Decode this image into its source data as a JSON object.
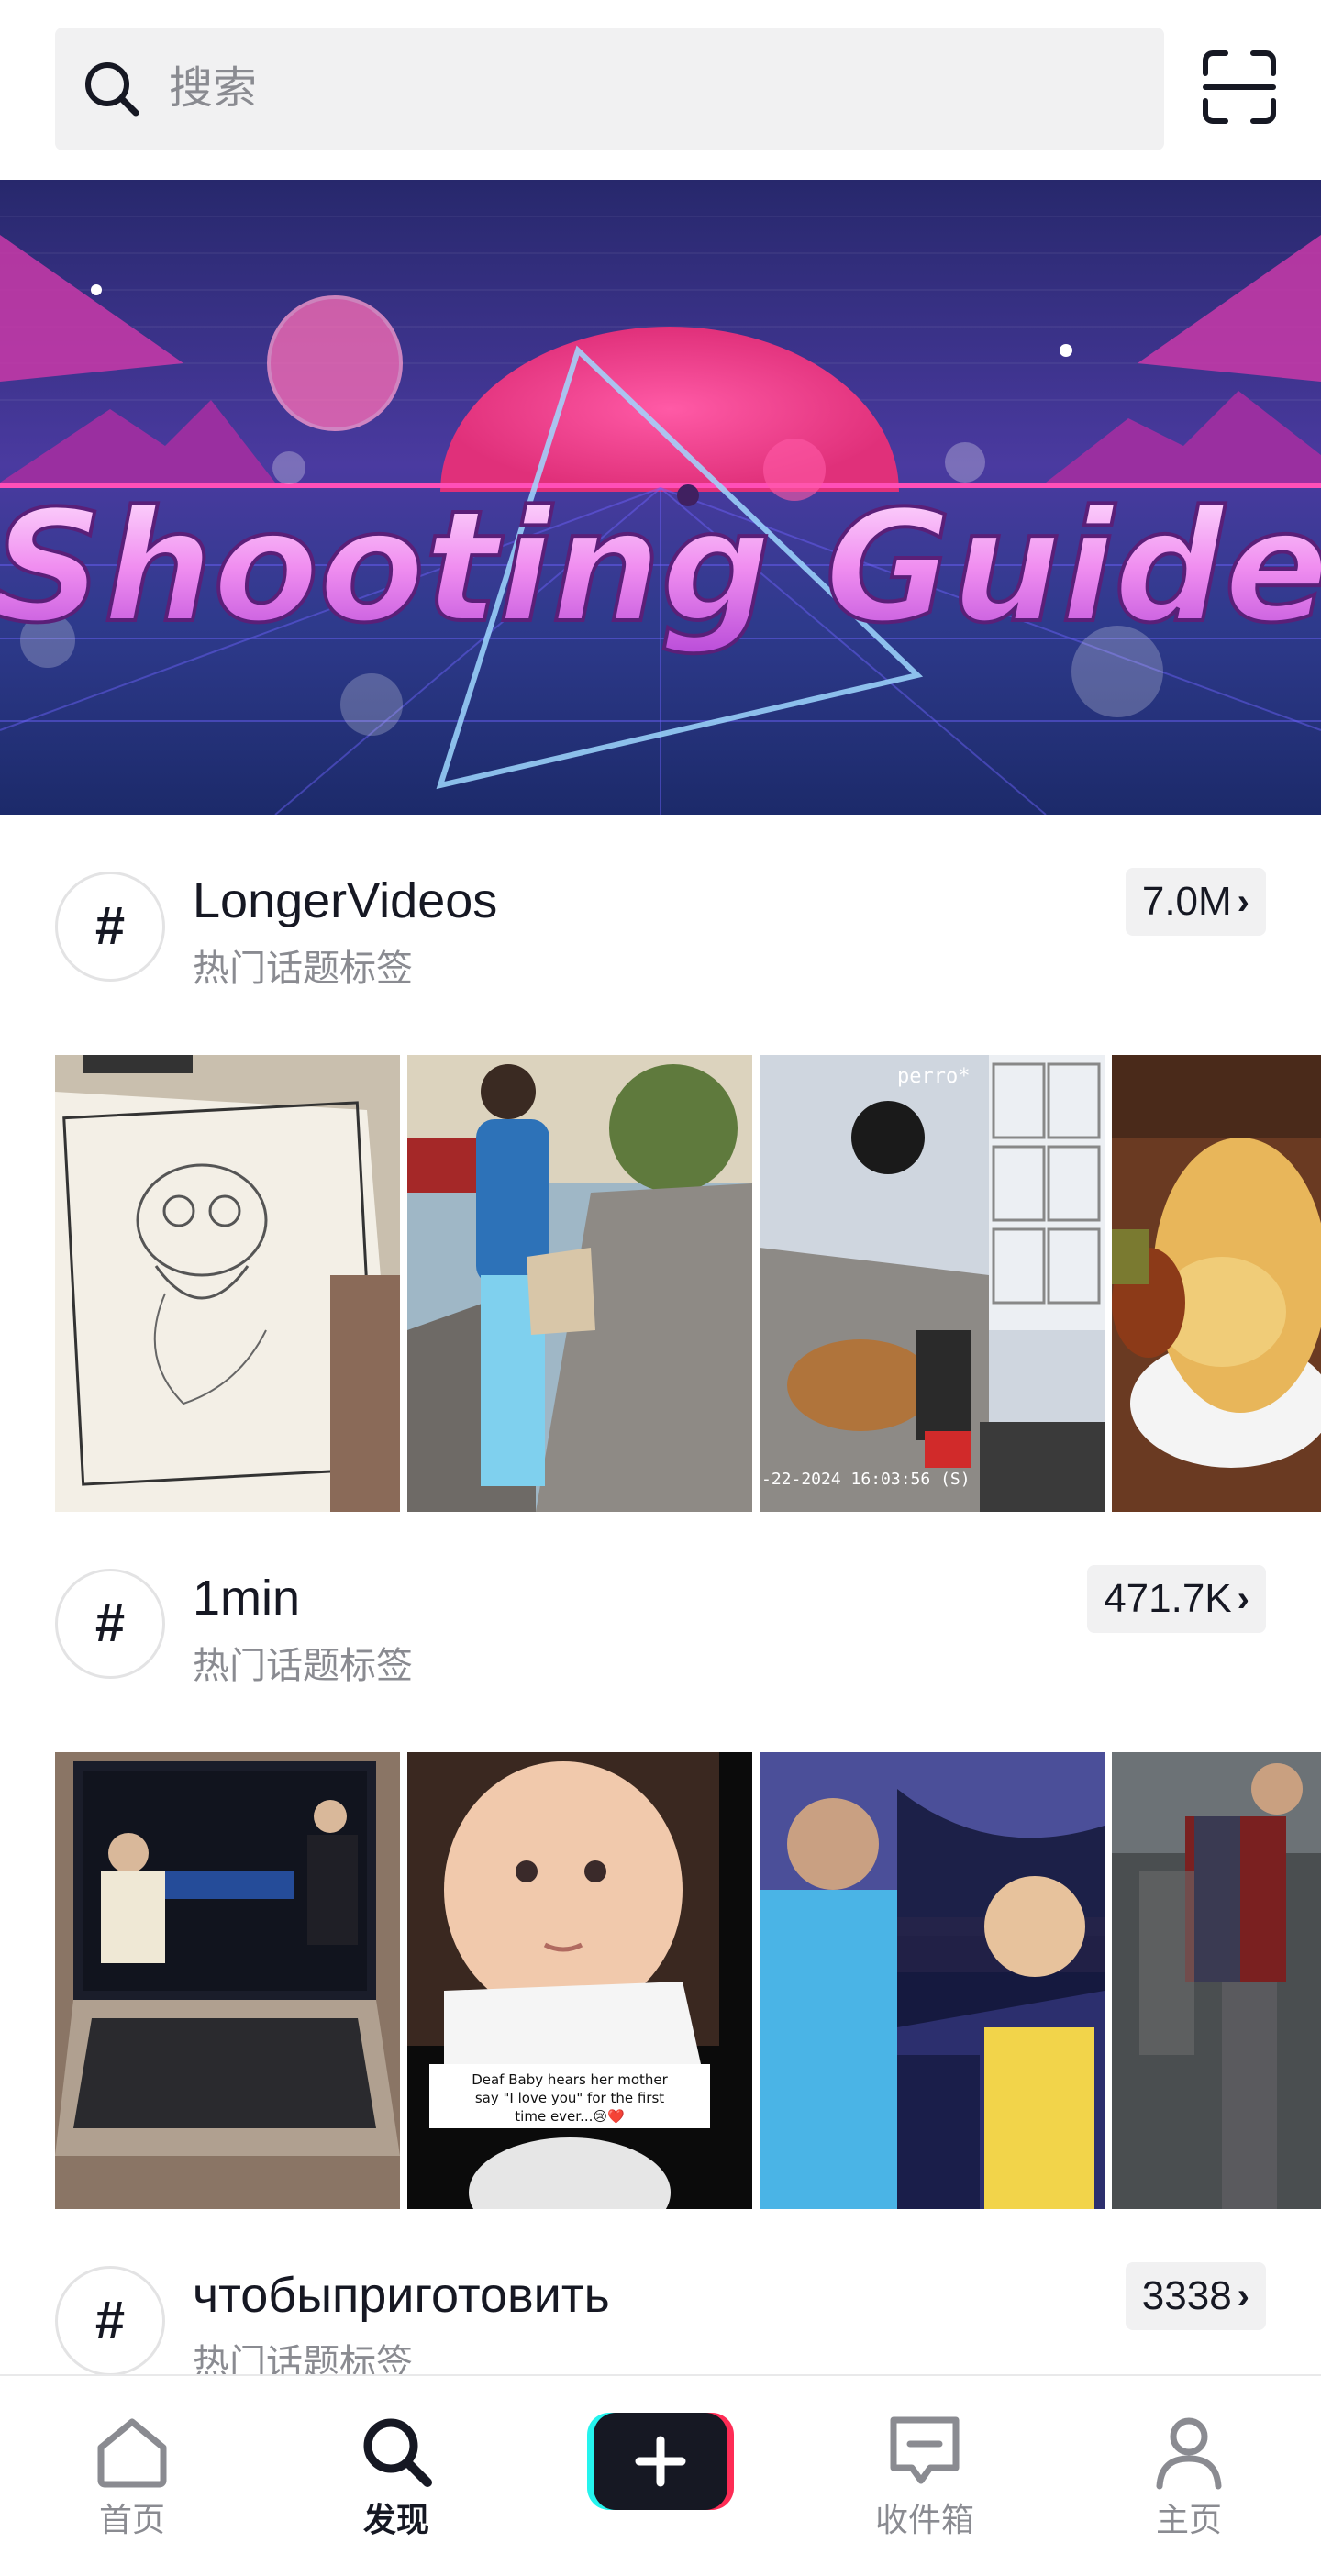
{
  "search": {
    "placeholder": "搜索"
  },
  "banner": {
    "title": "Shooting Guide"
  },
  "sections": [
    {
      "tag": "LongerVideos",
      "subtitle": "热门话题标签",
      "count": "7.0M"
    },
    {
      "tag": "1min",
      "subtitle": "热门话题标签",
      "count": "471.7K"
    },
    {
      "tag": "чтобыприготовить",
      "subtitle": "热门话题标签",
      "count": "3338"
    }
  ],
  "thumbnails": {
    "row1": {
      "thumb3_caption": "perro*",
      "thumb3_timestamp": "-22-2024 16:03:56 (S)"
    },
    "row2": {
      "thumb2_caption_line1": "Deaf Baby hears her mother",
      "thumb2_caption_line2": "say \"I love you\" for the first",
      "thumb2_caption_line3": "time ever...😢❤️"
    }
  },
  "nav": {
    "home": "首页",
    "discover": "发现",
    "inbox": "收件箱",
    "profile": "主页"
  },
  "icons": {
    "search": "search-icon",
    "scan": "scan-icon",
    "hash": "hashtag-icon",
    "chevron": "chevron-right-icon",
    "home": "home-icon",
    "discover": "discover-icon",
    "create": "plus-icon",
    "inbox": "inbox-icon",
    "profile": "profile-icon"
  },
  "colors": {
    "accent_cyan": "#25f4ee",
    "accent_red": "#fe2c55",
    "text_primary": "#161823",
    "text_secondary": "#8a8b91",
    "badge_bg": "#f1f1f2"
  }
}
